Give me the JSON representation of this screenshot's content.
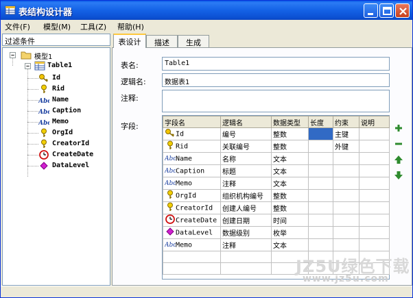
{
  "window": {
    "title": "表结构设计器"
  },
  "menu": [
    "文件(F)",
    "模型(M)",
    "工具(Z)",
    "帮助(H)"
  ],
  "left": {
    "filter_label": "过滤条件",
    "tree": {
      "root": "模型1",
      "table": "Table1",
      "fields": [
        "Id",
        "Rid",
        "Name",
        "Caption",
        "Memo",
        "OrgId",
        "CreatorId",
        "CreateDate",
        "DataLevel"
      ]
    }
  },
  "tabs": [
    "表设计",
    "描述",
    "生成"
  ],
  "form": {
    "table_name_label": "表名:",
    "table_name": "Table1",
    "logical_name_label": "逻辑名:",
    "logical_name": "数据表1",
    "comment_label": "注释:",
    "comment": "",
    "fields_label": "字段:"
  },
  "grid": {
    "columns": [
      "字段名",
      "逻辑名",
      "数据类型",
      "长度",
      "约束",
      "说明"
    ],
    "rows": [
      {
        "icon": "key-icon",
        "name": "Id",
        "logical": "编号",
        "type": "整数",
        "length": "",
        "constraint": "主键",
        "note": ""
      },
      {
        "icon": "yellow-key-icon",
        "name": "Rid",
        "logical": "关联编号",
        "type": "整数",
        "length": "",
        "constraint": "外键",
        "note": ""
      },
      {
        "icon": "abc-text-icon",
        "name": "Name",
        "logical": "名称",
        "type": "文本",
        "length": "",
        "constraint": "",
        "note": ""
      },
      {
        "icon": "abc-text-icon",
        "name": "Caption",
        "logical": "标题",
        "type": "文本",
        "length": "",
        "constraint": "",
        "note": ""
      },
      {
        "icon": "abc-text-icon",
        "name": "Memo",
        "logical": "注释",
        "type": "文本",
        "length": "",
        "constraint": "",
        "note": ""
      },
      {
        "icon": "yellow-key-icon",
        "name": "OrgId",
        "logical": "组织机构编号",
        "type": "整数",
        "length": "",
        "constraint": "",
        "note": ""
      },
      {
        "icon": "yellow-key-icon",
        "name": "CreatorId",
        "logical": "创建人编号",
        "type": "整数",
        "length": "",
        "constraint": "",
        "note": ""
      },
      {
        "icon": "clock-icon",
        "name": "CreateDate",
        "logical": "创建日期",
        "type": "时间",
        "length": "",
        "constraint": "",
        "note": ""
      },
      {
        "icon": "diamond-icon",
        "name": "DataLevel",
        "logical": "数据级别",
        "type": "枚举",
        "length": "",
        "constraint": "",
        "note": ""
      },
      {
        "icon": "abc-text-icon",
        "name": "Memo",
        "logical": "注释",
        "type": "文本",
        "length": "",
        "constraint": "",
        "note": ""
      }
    ]
  },
  "side_buttons": [
    "plus-icon",
    "minus-icon",
    "arrow-up-icon",
    "arrow-down-icon"
  ],
  "watermark": {
    "line1": "JZ5U绿色下载",
    "line2": "www.jz5u.com"
  },
  "colors": {
    "titlebar": "#0a5ae8",
    "selection": "#316ac5",
    "window_bg": "#ece9d8",
    "accent_green": "#2e8b2e"
  }
}
